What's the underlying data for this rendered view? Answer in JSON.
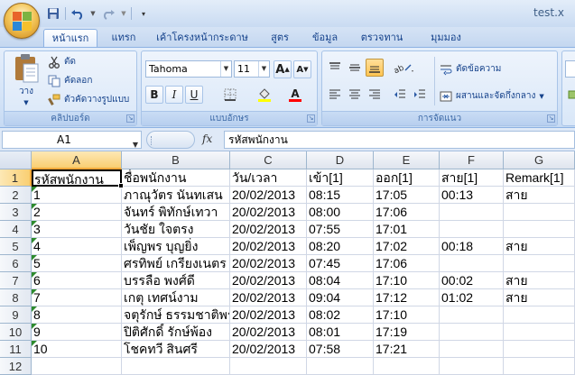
{
  "window": {
    "title": "test.x"
  },
  "quick_access": {
    "items": [
      "save-icon",
      "undo-icon",
      "redo-icon",
      "customize-qat-icon"
    ]
  },
  "ribbon": {
    "tabs": [
      {
        "label": "หน้าแรก",
        "active": true
      },
      {
        "label": "แทรก"
      },
      {
        "label": "เค้าโครงหน้ากระดาษ"
      },
      {
        "label": "สูตร"
      },
      {
        "label": "ข้อมูล"
      },
      {
        "label": "ตรวจทาน"
      },
      {
        "label": "มุมมอง"
      }
    ],
    "clipboard": {
      "label": "คลิปบอร์ด",
      "paste": "วาง",
      "cut": "ตัด",
      "copy": "คัดลอก",
      "format_painter": "ตัวคัดวางรูปแบบ"
    },
    "font": {
      "label": "แบบอักษร",
      "name": "Tahoma",
      "size": "11",
      "grow": "A",
      "shrink": "A",
      "bold": "B",
      "italic": "I",
      "underline": "U",
      "font_color_letter": "A",
      "fill_color": "#ffff00",
      "font_color": "#ff0000"
    },
    "alignment": {
      "label": "การจัดแนว",
      "wrap_text": "ตัดข้อความ",
      "merge_center": "ผสานและจัดกึ่งกลาง"
    }
  },
  "formula_bar": {
    "name_box": "A1",
    "fx": "fx",
    "formula": "รหัสพนักงาน"
  },
  "sheet": {
    "columns": [
      "A",
      "B",
      "C",
      "D",
      "E",
      "F",
      "G"
    ],
    "selected_column": "A",
    "active_cell": "A1",
    "rows": [
      {
        "num": "1",
        "cells": [
          "รหัสพนักงาน",
          "ชื่อพนักงาน",
          "วัน/เวลา",
          "เข้า[1]",
          "ออก[1]",
          "สาย[1]",
          "Remark[1]"
        ]
      },
      {
        "num": "2",
        "cells": [
          "1",
          "ภาณุวัตร นันทเสน",
          "20/02/2013",
          "08:15",
          "17:05",
          "00:13",
          "สาย"
        ]
      },
      {
        "num": "3",
        "cells": [
          "2",
          "จันทร์ พิทักษ์เทวา",
          "20/02/2013",
          "08:00",
          "17:06",
          "",
          ""
        ]
      },
      {
        "num": "4",
        "cells": [
          "3",
          "วันชัย ใจตรง",
          "20/02/2013",
          "07:55",
          "17:01",
          "",
          ""
        ]
      },
      {
        "num": "5",
        "cells": [
          "4",
          "เพ็ญพร บุญยิ่ง",
          "20/02/2013",
          "08:20",
          "17:02",
          "00:18",
          "สาย"
        ]
      },
      {
        "num": "6",
        "cells": [
          "5",
          "ศรทิพย์ เกรียงเนตร",
          "20/02/2013",
          "07:45",
          "17:06",
          "",
          ""
        ]
      },
      {
        "num": "7",
        "cells": [
          "6",
          "บรรลือ พงศ์ดี",
          "20/02/2013",
          "08:04",
          "17:10",
          "00:02",
          "สาย"
        ]
      },
      {
        "num": "8",
        "cells": [
          "7",
          "เกตุ เทศน์งาม",
          "20/02/2013",
          "09:04",
          "17:12",
          "01:02",
          "สาย"
        ]
      },
      {
        "num": "9",
        "cells": [
          "8",
          "จตุรักษ์ ธรรมชาติพร",
          "20/02/2013",
          "08:02",
          "17:10",
          "",
          ""
        ]
      },
      {
        "num": "10",
        "cells": [
          "9",
          "ปิติศักดิ์ รักษ์พ้อง",
          "20/02/2013",
          "08:01",
          "17:19",
          "",
          ""
        ]
      },
      {
        "num": "11",
        "cells": [
          "10",
          "โชคทวี สินศรี",
          "20/02/2013",
          "07:58",
          "17:21",
          "",
          ""
        ]
      },
      {
        "num": "12",
        "cells": [
          "",
          "",
          "",
          "",
          "",
          "",
          ""
        ]
      }
    ]
  }
}
